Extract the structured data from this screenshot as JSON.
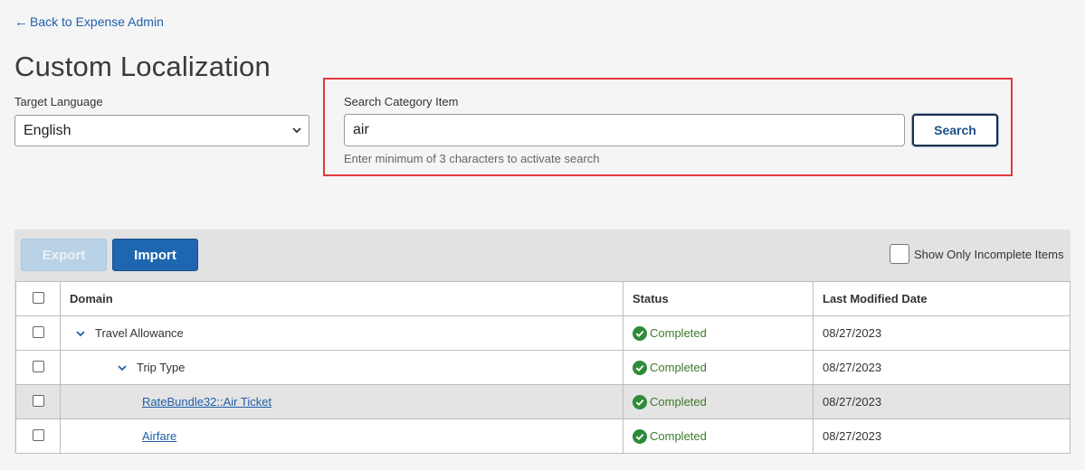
{
  "nav": {
    "back_label": "Back to Expense Admin"
  },
  "page": {
    "title": "Custom Localization"
  },
  "language": {
    "label": "Target Language",
    "selected": "English"
  },
  "search": {
    "label": "Search Category Item",
    "value": "air",
    "button_label": "Search",
    "hint": "Enter minimum of 3 characters to activate search"
  },
  "toolbar": {
    "export_label": "Export",
    "import_label": "Import",
    "incomplete_label": "Show Only Incomplete Items"
  },
  "table": {
    "headers": {
      "domain": "Domain",
      "status": "Status",
      "modified": "Last Modified Date"
    },
    "rows": [
      {
        "domain": "Travel Allowance",
        "status": "Completed",
        "modified": "08/27/2023"
      },
      {
        "domain": "Trip Type",
        "status": "Completed",
        "modified": "08/27/2023"
      },
      {
        "domain": "RateBundle32::Air Ticket",
        "status": "Completed",
        "modified": "08/27/2023"
      },
      {
        "domain": "Airfare",
        "status": "Completed",
        "modified": "08/27/2023"
      }
    ]
  },
  "colors": {
    "link": "#1f5fa8",
    "highlight_border": "#e0383e",
    "primary_button": "#1f66b0",
    "completed": "#2e8b3a"
  }
}
